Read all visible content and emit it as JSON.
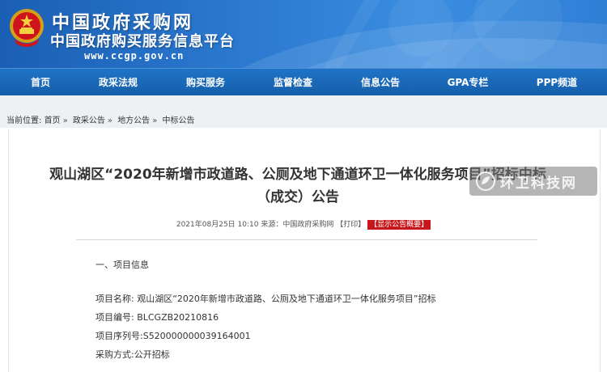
{
  "header": {
    "site_title": "中国政府采购网",
    "site_subtitle": "中国政府购买服务信息平台",
    "site_url": "www.ccgp.gov.cn"
  },
  "nav": {
    "items": [
      "首页",
      "政采法规",
      "购买服务",
      "监督检查",
      "信息公告",
      "GPA专栏",
      "PPP频道"
    ]
  },
  "breadcrumb": {
    "label": "当前位置:",
    "items": [
      "首页",
      "政采公告",
      "地方公告",
      "中标公告"
    ],
    "separator": "»"
  },
  "article": {
    "title_line1": "观山湖区“2020年新增市政道路、公厕及地下通道环卫一体化服务项目”招标中标",
    "title_line2": "（成交）公告",
    "date": "2021年08月25日 10:10",
    "source": "来源：中国政府采购网",
    "print_label": "【打印】",
    "summary_button": "【显示公告概要】",
    "section_title": "一、项目信息",
    "info": [
      "项目名称: 观山湖区“2020年新增市政道路、公厕及地下通道环卫一体化服务项目”招标",
      "项目编号: BLCGZB20210816",
      "项目序列号:S520000000039164001",
      "采购方式:公开招标"
    ]
  },
  "watermark": {
    "text": "环卫科技网",
    "icon": "leaf-circle-icon"
  },
  "colors": {
    "banner": "#2a78cf",
    "nav": "#155ea9",
    "summary_button": "#c7171a"
  }
}
